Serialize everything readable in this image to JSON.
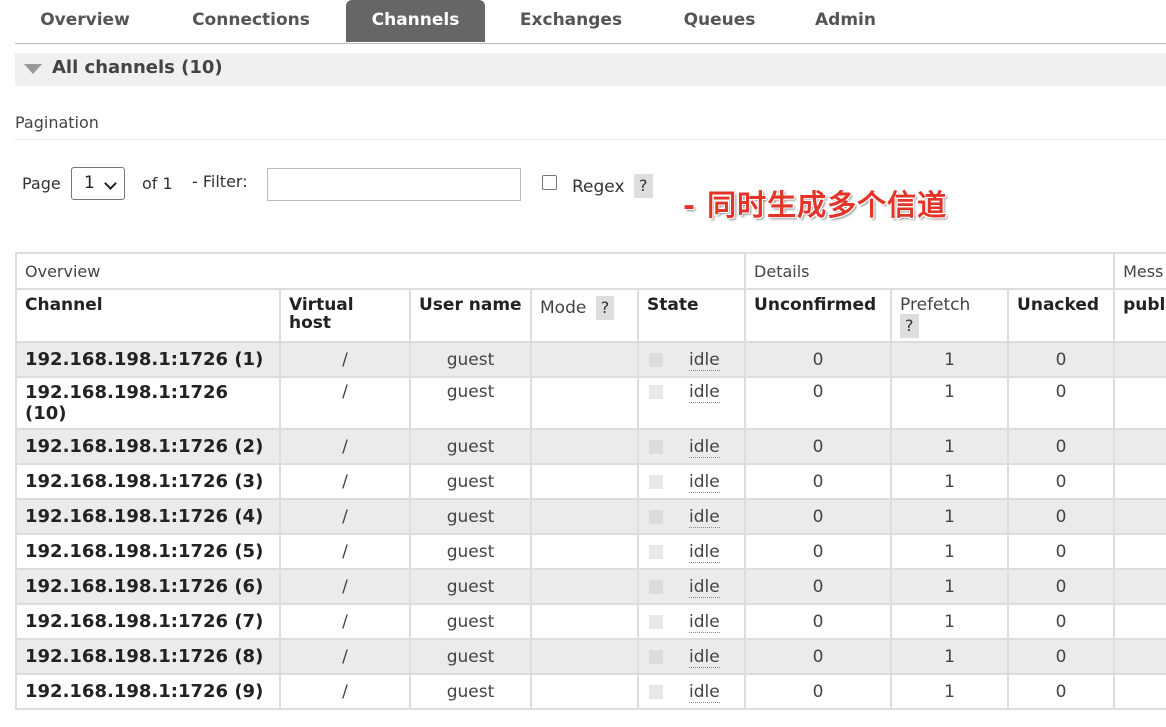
{
  "tabs": [
    {
      "label": "Overview"
    },
    {
      "label": "Connections"
    },
    {
      "label": "Channels",
      "active": true
    },
    {
      "label": "Exchanges"
    },
    {
      "label": "Queues"
    },
    {
      "label": "Admin"
    }
  ],
  "section": {
    "title": "All channels (10)"
  },
  "pagination": {
    "heading": "Pagination",
    "page_label": "Page",
    "page_value": "1",
    "of_label": "of 1",
    "filter_label": "- Filter:",
    "filter_value": "",
    "regex_label": "Regex",
    "help": "?"
  },
  "annotation": "- 同时生成多个信道",
  "table": {
    "groups": [
      "Overview",
      "Details",
      "Mess"
    ],
    "columns": {
      "channel": "Channel",
      "vhost": "Virtual host",
      "user": "User name",
      "mode": "Mode",
      "state": "State",
      "unconfirmed": "Unconfirmed",
      "prefetch": "Prefetch",
      "unacked": "Unacked",
      "publish": "publ"
    },
    "rows": [
      {
        "channel": "192.168.198.1:1726 (1)",
        "vhost": "/",
        "user": "guest",
        "mode": "",
        "state": "idle",
        "unconfirmed": "0",
        "prefetch": "1",
        "unacked": "0",
        "publish": ""
      },
      {
        "channel": "192.168.198.1:1726 (10)",
        "vhost": "/",
        "user": "guest",
        "mode": "",
        "state": "idle",
        "unconfirmed": "0",
        "prefetch": "1",
        "unacked": "0",
        "publish": ""
      },
      {
        "channel": "192.168.198.1:1726 (2)",
        "vhost": "/",
        "user": "guest",
        "mode": "",
        "state": "idle",
        "unconfirmed": "0",
        "prefetch": "1",
        "unacked": "0",
        "publish": ""
      },
      {
        "channel": "192.168.198.1:1726 (3)",
        "vhost": "/",
        "user": "guest",
        "mode": "",
        "state": "idle",
        "unconfirmed": "0",
        "prefetch": "1",
        "unacked": "0",
        "publish": ""
      },
      {
        "channel": "192.168.198.1:1726 (4)",
        "vhost": "/",
        "user": "guest",
        "mode": "",
        "state": "idle",
        "unconfirmed": "0",
        "prefetch": "1",
        "unacked": "0",
        "publish": ""
      },
      {
        "channel": "192.168.198.1:1726 (5)",
        "vhost": "/",
        "user": "guest",
        "mode": "",
        "state": "idle",
        "unconfirmed": "0",
        "prefetch": "1",
        "unacked": "0",
        "publish": ""
      },
      {
        "channel": "192.168.198.1:1726 (6)",
        "vhost": "/",
        "user": "guest",
        "mode": "",
        "state": "idle",
        "unconfirmed": "0",
        "prefetch": "1",
        "unacked": "0",
        "publish": ""
      },
      {
        "channel": "192.168.198.1:1726 (7)",
        "vhost": "/",
        "user": "guest",
        "mode": "",
        "state": "idle",
        "unconfirmed": "0",
        "prefetch": "1",
        "unacked": "0",
        "publish": ""
      },
      {
        "channel": "192.168.198.1:1726 (8)",
        "vhost": "/",
        "user": "guest",
        "mode": "",
        "state": "idle",
        "unconfirmed": "0",
        "prefetch": "1",
        "unacked": "0",
        "publish": ""
      },
      {
        "channel": "192.168.198.1:1726 (9)",
        "vhost": "/",
        "user": "guest",
        "mode": "",
        "state": "idle",
        "unconfirmed": "0",
        "prefetch": "1",
        "unacked": "0",
        "publish": ""
      }
    ]
  }
}
